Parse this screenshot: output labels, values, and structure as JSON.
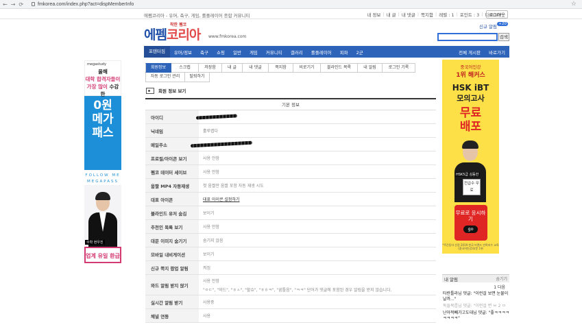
{
  "browser": {
    "url": "fmkorea.com/index.php?act=dispMemberInfo",
    "back_icon": "arrow-left-icon",
    "forward_icon": "arrow-right-icon",
    "reload_icon": "reload-icon",
    "bookmark_icon": "star-icon"
  },
  "topbar": {
    "site_title": "에펨코리아 - 유머, 축구, 게임, 롤플레이어 종합 커뮤니티",
    "util": [
      "내 정보",
      "내 글",
      "내 댓글",
      "쪽지함",
      "레벨 : 1",
      "포인트 : 3",
      "다크OFF"
    ],
    "logout": "로그아웃"
  },
  "header": {
    "logo_small": "착한 펨코",
    "logo_main": "에펨",
    "logo_accent": "코리아",
    "logo_url": "www.fmkorea.com",
    "signup": "신규 알림",
    "badge": "+20",
    "search_placeholder": "",
    "search_btn": "검색"
  },
  "mainnav": {
    "items": [
      "포텐터짐",
      "유머/정보",
      "축구",
      "쇼핑",
      "일반",
      "게임",
      "커뮤니티",
      "갤러리",
      "롤플레이어",
      "피파",
      "2군"
    ],
    "right": [
      "전체 게시판",
      "바로가기"
    ]
  },
  "ad_left": {
    "brand": "megastudy",
    "line1": "올해",
    "line2": "대학 합격자들이",
    "line3a": "가장 많이",
    "line3b": " 수강한",
    "big": [
      "0원",
      "메가",
      "패스"
    ],
    "follow": "FOLLOW ME",
    "follow2": "MEGAPASS",
    "name": "수학 현우진",
    "bottom": "업계 유일 환급"
  },
  "ad_right": {
    "l1": "중국어인강",
    "l2": "1위 해커스",
    "l3": "HSK iBT",
    "l4": "모의고사",
    "l5a": "무료",
    "l5b": "배포",
    "tag": "HSK5급 김동한",
    "box": "전급수 무료",
    "cta": "무료로 응시하기",
    "go": "go",
    "foot": "*주간동아 선정 2019 한국 브랜드 만족지수 교육(중국어인강)부문 1위"
  },
  "tabs": {
    "row1": [
      "회원정보",
      "스크랩",
      "저장함",
      "내 글",
      "내 댓글",
      "쪽지함",
      "비로기기",
      "블라인드 목록",
      "내 알림",
      "로그인 기록"
    ],
    "row2": [
      "자동 로그인 관리",
      "탈퇴하기"
    ]
  },
  "section": {
    "title": "회원 정보 보기"
  },
  "table": {
    "header": "기본 정보",
    "rows": [
      {
        "k": "아이디",
        "v": ""
      },
      {
        "k": "닉네임",
        "v": "훌루랩다"
      },
      {
        "k": "메일주소",
        "v": ""
      },
      {
        "k": "프로필/아이콘 보기",
        "v": "사용 안함"
      },
      {
        "k": "펨코 데이터 세이브",
        "v": "사용 안함"
      },
      {
        "k": "움짤 MP4 자동재생",
        "v": "첫 움짤만 움짤 포함 자동 재생 시도"
      },
      {
        "k": "대표 아이콘",
        "v": "대표 아이콘 설정하기"
      },
      {
        "k": "블라인드 유저 숨김",
        "v": "보이기"
      },
      {
        "k": "추천인 목록 보기",
        "v": "사용 안함"
      },
      {
        "k": "대문 이미지 숨기기",
        "v": "숨기지 않음"
      },
      {
        "k": "모바일 내비게이션",
        "v": "보이기"
      },
      {
        "k": "신규 쪽지 팝업 알림",
        "v": "켜짐"
      },
      {
        "k": "와드 알림 받지 않기",
        "v": "사용 안함",
        "v2": "\"ㅇㄷ\", \"와드\", \"ㅎㅅ\", \"할슈\", \"ㅎㅎㅋ\", \"꿈틀음\", \"ㅋㅋ\" 단어가 댓글에 포함된 경우 알림을 받지 않습니다."
      },
      {
        "k": "실시간 알림 받기",
        "v": "사용중"
      },
      {
        "k": "채널 연동",
        "v": "사용"
      }
    ]
  },
  "my_alarm": {
    "title": "내 알림",
    "more": "숨기기",
    "pager": "1  다음",
    "items": [
      {
        "a": "타란틀라님 댓글: \"이런걸 보면 눈물이 날까...\"",
        "b": ""
      },
      {
        "a": "독들목릅님 댓글: \"이런걸 변 ",
        "b": "ㅂ 2 ㅁ"
      },
      {
        "a": "난아적빼가고도대님 댓글: \"좋ㅋㅋㅋㅋㅋㅋㅋㅋ\"",
        "b": ""
      }
    ]
  }
}
